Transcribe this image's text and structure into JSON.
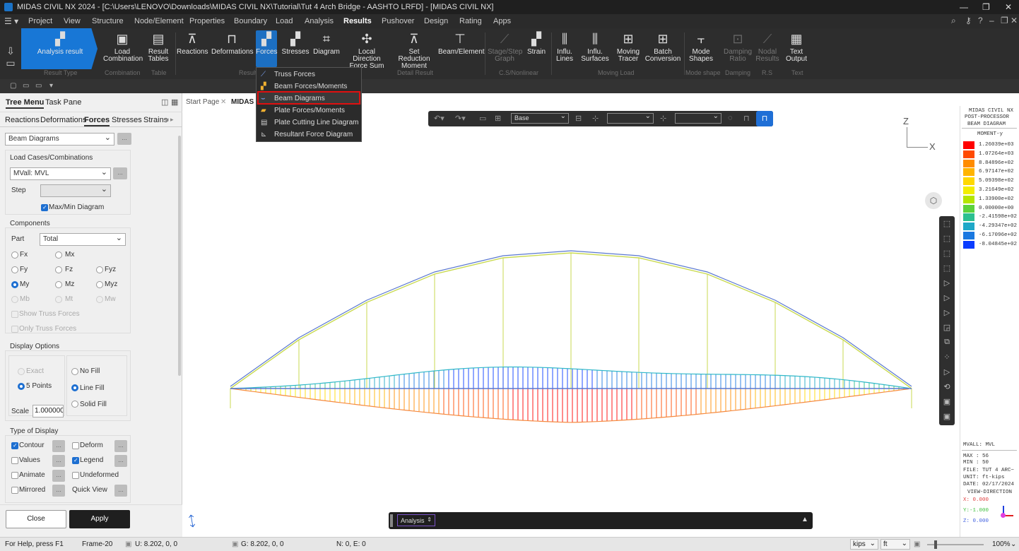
{
  "titlebar": {
    "title": "MIDAS CIVIL NX 2024 - [C:\\Users\\LENOVO\\Downloads\\MIDAS CIVIL NX\\Tutorial\\Tut 4 Arch Bridge - AASHTO LRFD] - [MIDAS CIVIL NX]"
  },
  "menubar": {
    "items": [
      "Project",
      "View",
      "Structure",
      "Node/Element",
      "Properties",
      "Boundary",
      "Load",
      "Analysis",
      "Results",
      "Pushover",
      "Design",
      "Rating",
      "Apps"
    ],
    "active": "Results"
  },
  "ribbon": {
    "buttons": [
      {
        "id": "analysis-result",
        "label": "Analysis result"
      },
      {
        "id": "load-combination",
        "label": "Load\nCombination"
      },
      {
        "id": "result-tables",
        "label": "Result\nTables"
      },
      {
        "id": "reactions",
        "label": "Reactions"
      },
      {
        "id": "deformations",
        "label": "Deformations"
      },
      {
        "id": "forces",
        "label": "Forces"
      },
      {
        "id": "stresses",
        "label": "Stresses"
      },
      {
        "id": "diagram",
        "label": "Diagram"
      },
      {
        "id": "local-direction",
        "label": "Local Direction\nForce Sum"
      },
      {
        "id": "set-reduction",
        "label": "Set Reduction\nMoment"
      },
      {
        "id": "beam-element",
        "label": "Beam/Element"
      },
      {
        "id": "stage-step",
        "label": "Stage/Step\nGraph"
      },
      {
        "id": "strain",
        "label": "Strain"
      },
      {
        "id": "influ-lines",
        "label": "Influ.\nLines"
      },
      {
        "id": "influ-surfaces",
        "label": "Influ.\nSurfaces"
      },
      {
        "id": "moving-tracer",
        "label": "Moving\nTracer"
      },
      {
        "id": "batch-conversion",
        "label": "Batch\nConversion"
      },
      {
        "id": "mode-shapes",
        "label": "Mode\nShapes"
      },
      {
        "id": "damping-ratio",
        "label": "Damping\nRatio"
      },
      {
        "id": "nodal-results",
        "label": "Nodal\nResults"
      },
      {
        "id": "text-output",
        "label": "Text\nOutput"
      }
    ],
    "groups": [
      "Result Type",
      "Combination",
      "Table",
      "Result",
      "Detail Result",
      "C.S/Nonlinear",
      "Moving Load",
      "Mode shape",
      "Damping",
      "R.S",
      "Text"
    ]
  },
  "forces_menu": {
    "items": [
      "Truss Forces",
      "Beam Forces/Moments",
      "Beam Diagrams",
      "Plate Forces/Moments",
      "Plate Cutting Line Diagram",
      "Resultant Force Diagram"
    ],
    "highlighted": "Beam Diagrams"
  },
  "leftpanel": {
    "tabs": [
      "Tree Menu",
      "Task Pane"
    ],
    "subtabs": [
      "Reactions",
      "Deformations",
      "Forces",
      "Stresses",
      "Strains"
    ],
    "active_subtab": "Forces",
    "result_type": "Beam Diagrams",
    "load_cases_label": "Load Cases/Combinations",
    "load_case": "MVall: MVL",
    "step_label": "Step",
    "maxmin_label": "Max/Min Diagram",
    "components_label": "Components",
    "part_label": "Part",
    "part_value": "Total",
    "components": [
      "Fx",
      "Mx",
      "Fy",
      "Fz",
      "Fyz",
      "My",
      "Mz",
      "Myz",
      "Mb",
      "Mt",
      "Mw"
    ],
    "show_truss": "Show Truss Forces",
    "only_truss": "Only Truss Forces",
    "display_options_label": "Display Options",
    "exact": "Exact",
    "five_points": "5 Points",
    "no_fill": "No Fill",
    "line_fill": "Line Fill",
    "solid_fill": "Solid Fill",
    "scale_label": "Scale",
    "scale_value": "1.000000",
    "type_of_display_label": "Type of Display",
    "contour": "Contour",
    "deform": "Deform",
    "values": "Values",
    "legend": "Legend",
    "animate": "Animate",
    "undeformed": "Undeformed",
    "mirrored": "Mirrored",
    "quick_view": "Quick View",
    "close": "Close",
    "apply": "Apply"
  },
  "viewtabs": {
    "start": "Start Page",
    "midas": "MIDAS C"
  },
  "viewtoolbar": {
    "base": "Base"
  },
  "axes": {
    "z": "Z",
    "x": "X"
  },
  "legend": {
    "header": [
      "MIDAS CIVIL NX",
      "POST-PROCESSOR",
      "BEAM DIAGRAM"
    ],
    "quantity": "MOMENT-y",
    "values": [
      "1.26039e+03",
      "1.07264e+03",
      "8.84896e+02",
      "6.97147e+02",
      "5.09398e+02",
      "3.21649e+02",
      "1.33900e+02",
      "0.00000e+00",
      "-2.41598e+02",
      "-4.29347e+02",
      "-6.17096e+02",
      "-8.04845e+02"
    ],
    "colors": [
      "#ff0000",
      "#ff4a00",
      "#ff8c00",
      "#ffb400",
      "#ffd800",
      "#f2ee00",
      "#b4e600",
      "#5cd23c",
      "#2cc090",
      "#1fa8c8",
      "#1a78e0",
      "#0a3cff"
    ],
    "case": "MVALL: MVL",
    "max": "MAX : 56",
    "min": "MIN : 50",
    "file": "FILE: TUT 4 ARC~",
    "unit": "UNIT: ft-kips",
    "date": "DATE: 02/17/2024",
    "view_direction": "VIEW-DIRECTION",
    "vx": "X: 0.000",
    "vy": "Y:-1.000",
    "vz": "Z: 0.000"
  },
  "analysisbar": {
    "label": "Analysis"
  },
  "statusbar": {
    "help": "For Help, press F1",
    "frame": "Frame-20",
    "u": "U: 8.202, 0, 0",
    "g": "G: 8.202, 0, 0",
    "ne": "N: 0, E: 0",
    "force_unit": "kips",
    "length_unit": "ft",
    "zoom": "100%"
  }
}
